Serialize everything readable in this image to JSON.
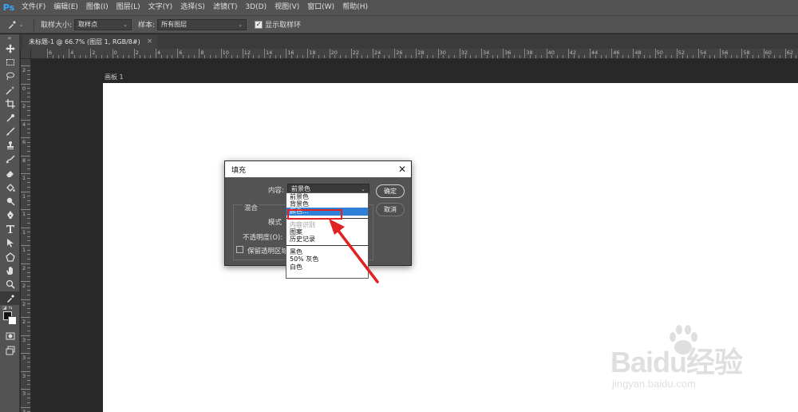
{
  "app": {
    "logo": "Ps"
  },
  "menu": [
    "文件(F)",
    "编辑(E)",
    "图像(I)",
    "图层(L)",
    "文字(Y)",
    "选择(S)",
    "滤镜(T)",
    "3D(D)",
    "视图(V)",
    "窗口(W)",
    "帮助(H)"
  ],
  "options": {
    "sample_size_label": "取样大小:",
    "sample_size_value": "取样点",
    "sample_label": "样本:",
    "sample_value": "所有图层",
    "show_ring_label": "显示取样环",
    "show_ring_checked": true
  },
  "document_tab": {
    "title": "未标题-1 @ 66.7% (图层 1, RGB/8#)",
    "close": "×"
  },
  "ruler": {
    "top": [
      "6",
      "4",
      "2",
      "0",
      "2",
      "4",
      "6",
      "8",
      "10",
      "12",
      "14",
      "16",
      "18",
      "20",
      "22",
      "24",
      "26",
      "28",
      "30",
      "32",
      "34",
      "36",
      "38",
      "40",
      "42",
      "44",
      "46",
      "48",
      "50",
      "52",
      "54",
      "56",
      "58",
      "60",
      "62",
      "64"
    ],
    "left": [
      "2",
      "0",
      "2",
      "4",
      "6",
      "8",
      "1",
      "1",
      "1",
      "1",
      "1",
      "2",
      "2",
      "2",
      "2",
      "3",
      "3",
      "3",
      "3",
      "3"
    ]
  },
  "artboard": {
    "label": "画板 1"
  },
  "fill_dialog": {
    "title": "填充",
    "close": "✕",
    "content_label": "内容:",
    "content_value": "前景色",
    "blend_label": "混合",
    "mode_label": "模式",
    "opacity_label": "不透明度(O):",
    "preserve_label": "保留透明区域",
    "ok_label": "确定",
    "cancel_label": "取消"
  },
  "content_dropdown": {
    "groups": [
      [
        {
          "label": "前景色",
          "state": "normal"
        },
        {
          "label": "背景色",
          "state": "normal"
        },
        {
          "label": "颜色...",
          "state": "selected"
        }
      ],
      [
        {
          "label": "内容识别",
          "state": "disabled"
        },
        {
          "label": "图案",
          "state": "normal"
        },
        {
          "label": "历史记录",
          "state": "normal"
        }
      ],
      [
        {
          "label": "黑色",
          "state": "normal"
        },
        {
          "label": "50% 灰色",
          "state": "normal"
        },
        {
          "label": "白色",
          "state": "normal"
        }
      ]
    ]
  },
  "annotation": {
    "highlight_color": "#e02222"
  },
  "watermark": {
    "text": "Baidu经验",
    "url": "jingyan.baidu.com"
  },
  "colors": {
    "accent": "#31a8ff",
    "selection": "#2e80d8",
    "panel": "#535353",
    "canvas_bg": "#282828"
  }
}
